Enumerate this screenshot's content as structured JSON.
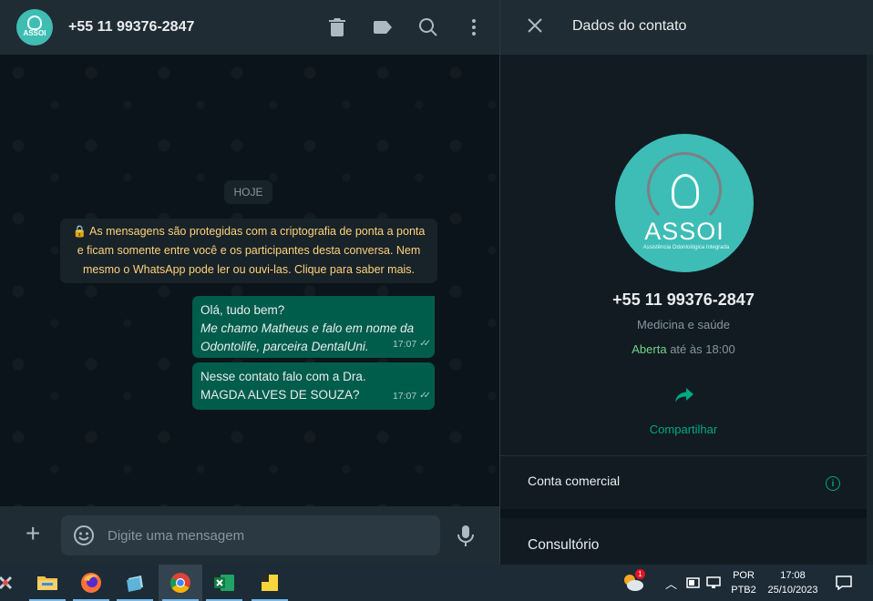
{
  "chat": {
    "header": {
      "avatar_text": "ASSOI",
      "title": "+55 11 99376-2847"
    },
    "date_chip": "HOJE",
    "system_message": "As mensagens são protegidas com a criptografia de ponta a ponta e ficam somente entre você e os participantes desta conversa. Nem mesmo o WhatsApp pode ler ou ouvi-las. Clique para saber mais.",
    "messages": [
      {
        "line1": "Olá, tudo bem?",
        "line2": "Me chamo Matheus e falo em nome da Odontolife, parceira DentalUni.",
        "time": "17:07"
      },
      {
        "text": "Nesse contato falo com a Dra. MAGDA ALVES DE SOUZA?",
        "time": "17:07"
      }
    ],
    "composer": {
      "placeholder": "Digite uma mensagem"
    }
  },
  "contact": {
    "title": "Dados do contato",
    "avatar_brand": "ASSOI",
    "avatar_sub": "Assistência Odontológica Integrada",
    "phone": "+55 11 99376-2847",
    "category": "Medicina e saúde",
    "hours_status": "Aberta",
    "hours_rest": "até às 18:00",
    "share_label": "Compartilhar",
    "business_label": "Conta comercial",
    "info_icon": "i",
    "next_section_label": "Consultório"
  },
  "taskbar": {
    "lang_top": "POR",
    "lang_bottom": "PTB2",
    "time": "17:08",
    "date": "25/10/2023",
    "notif_badge": "1"
  },
  "colors": {
    "accent": "#00a884",
    "bubble_out": "#005c4b",
    "system_text": "#ffd279",
    "open_status": "#71d48a",
    "brand_teal": "#3dbdb5"
  }
}
